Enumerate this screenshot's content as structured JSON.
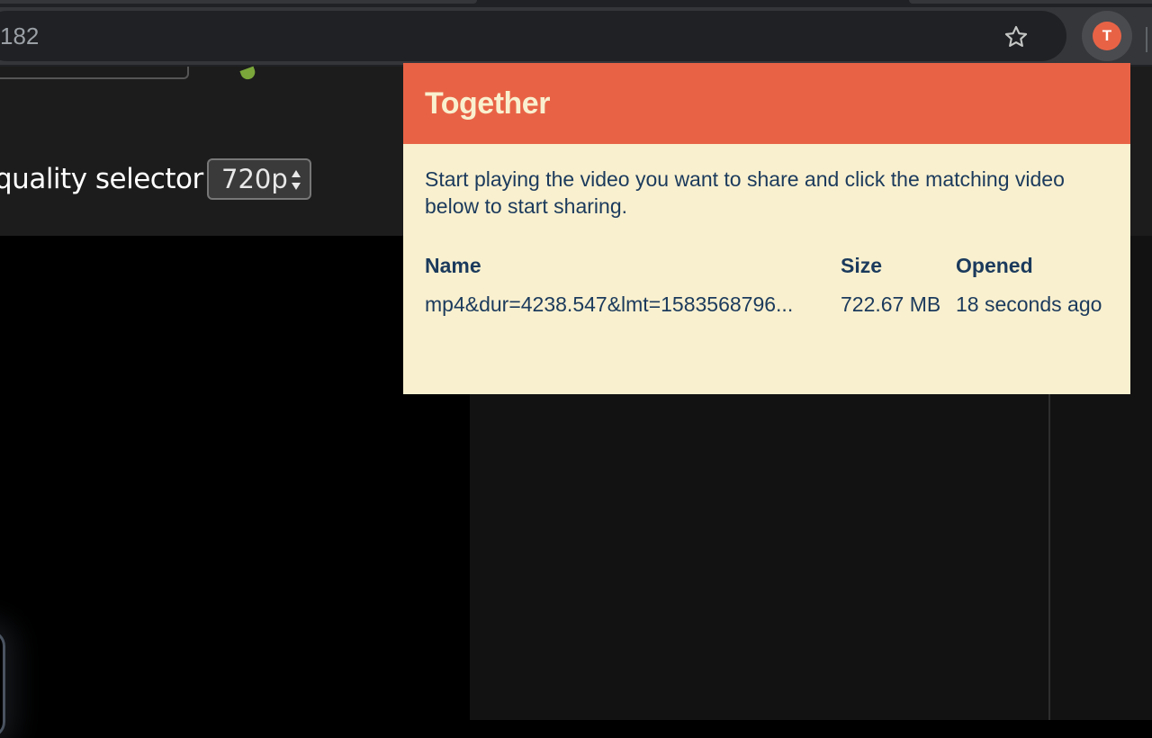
{
  "browser": {
    "omnibox_text": "182",
    "extension_avatar_letter": "T"
  },
  "page": {
    "quality_label": "quality selector",
    "quality_value": "720p"
  },
  "popup": {
    "title": "Together",
    "description": "Start playing the video you want to share and click the matching video below to start sharing.",
    "columns": [
      "Name",
      "Size",
      "Opened"
    ],
    "rows": [
      {
        "name": "mp4&dur=4238.547&lmt=1583568796...",
        "size": "722.67 MB",
        "opened": "18 seconds ago"
      }
    ]
  },
  "colors": {
    "accent": "#e86346",
    "popup_background": "#f9f0cf",
    "text": "#1b3a5c"
  }
}
